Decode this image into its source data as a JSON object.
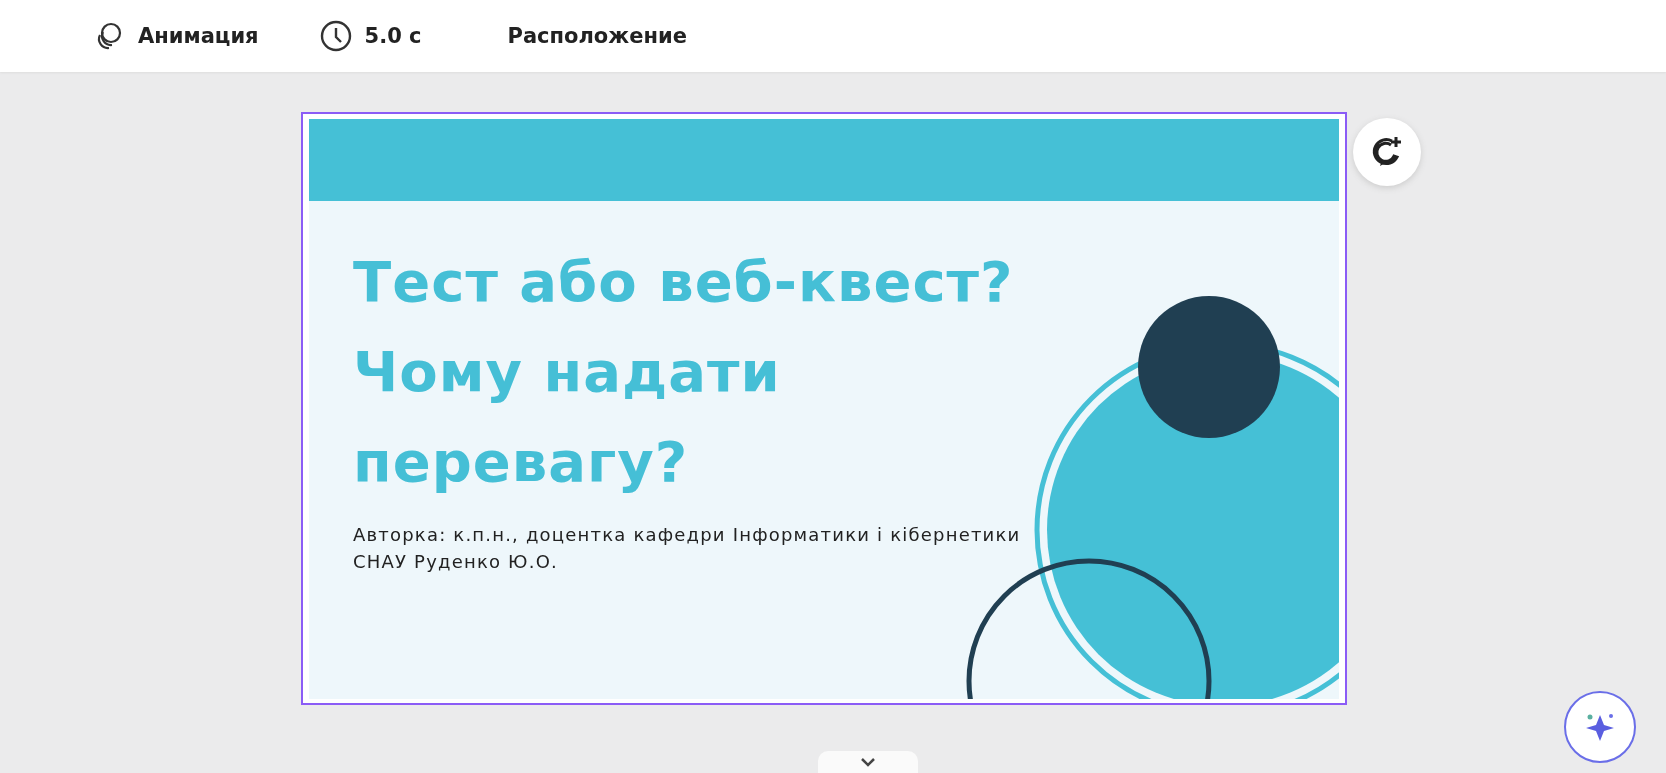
{
  "toolbar": {
    "items": [
      {
        "kind": "animation",
        "label": "Анимация"
      },
      {
        "kind": "duration",
        "label": "5.0 с"
      },
      {
        "kind": "position",
        "label": "Расположение"
      }
    ]
  },
  "slide": {
    "selected": true,
    "title_lines": [
      "Тест або веб-квест?",
      "Чому надати",
      "перевагу?"
    ],
    "author_lines": [
      "Авторка: к.п.н., доцентка кафедри Інформатики і кібернетики",
      "СНАУ Руденко Ю.О."
    ]
  }
}
